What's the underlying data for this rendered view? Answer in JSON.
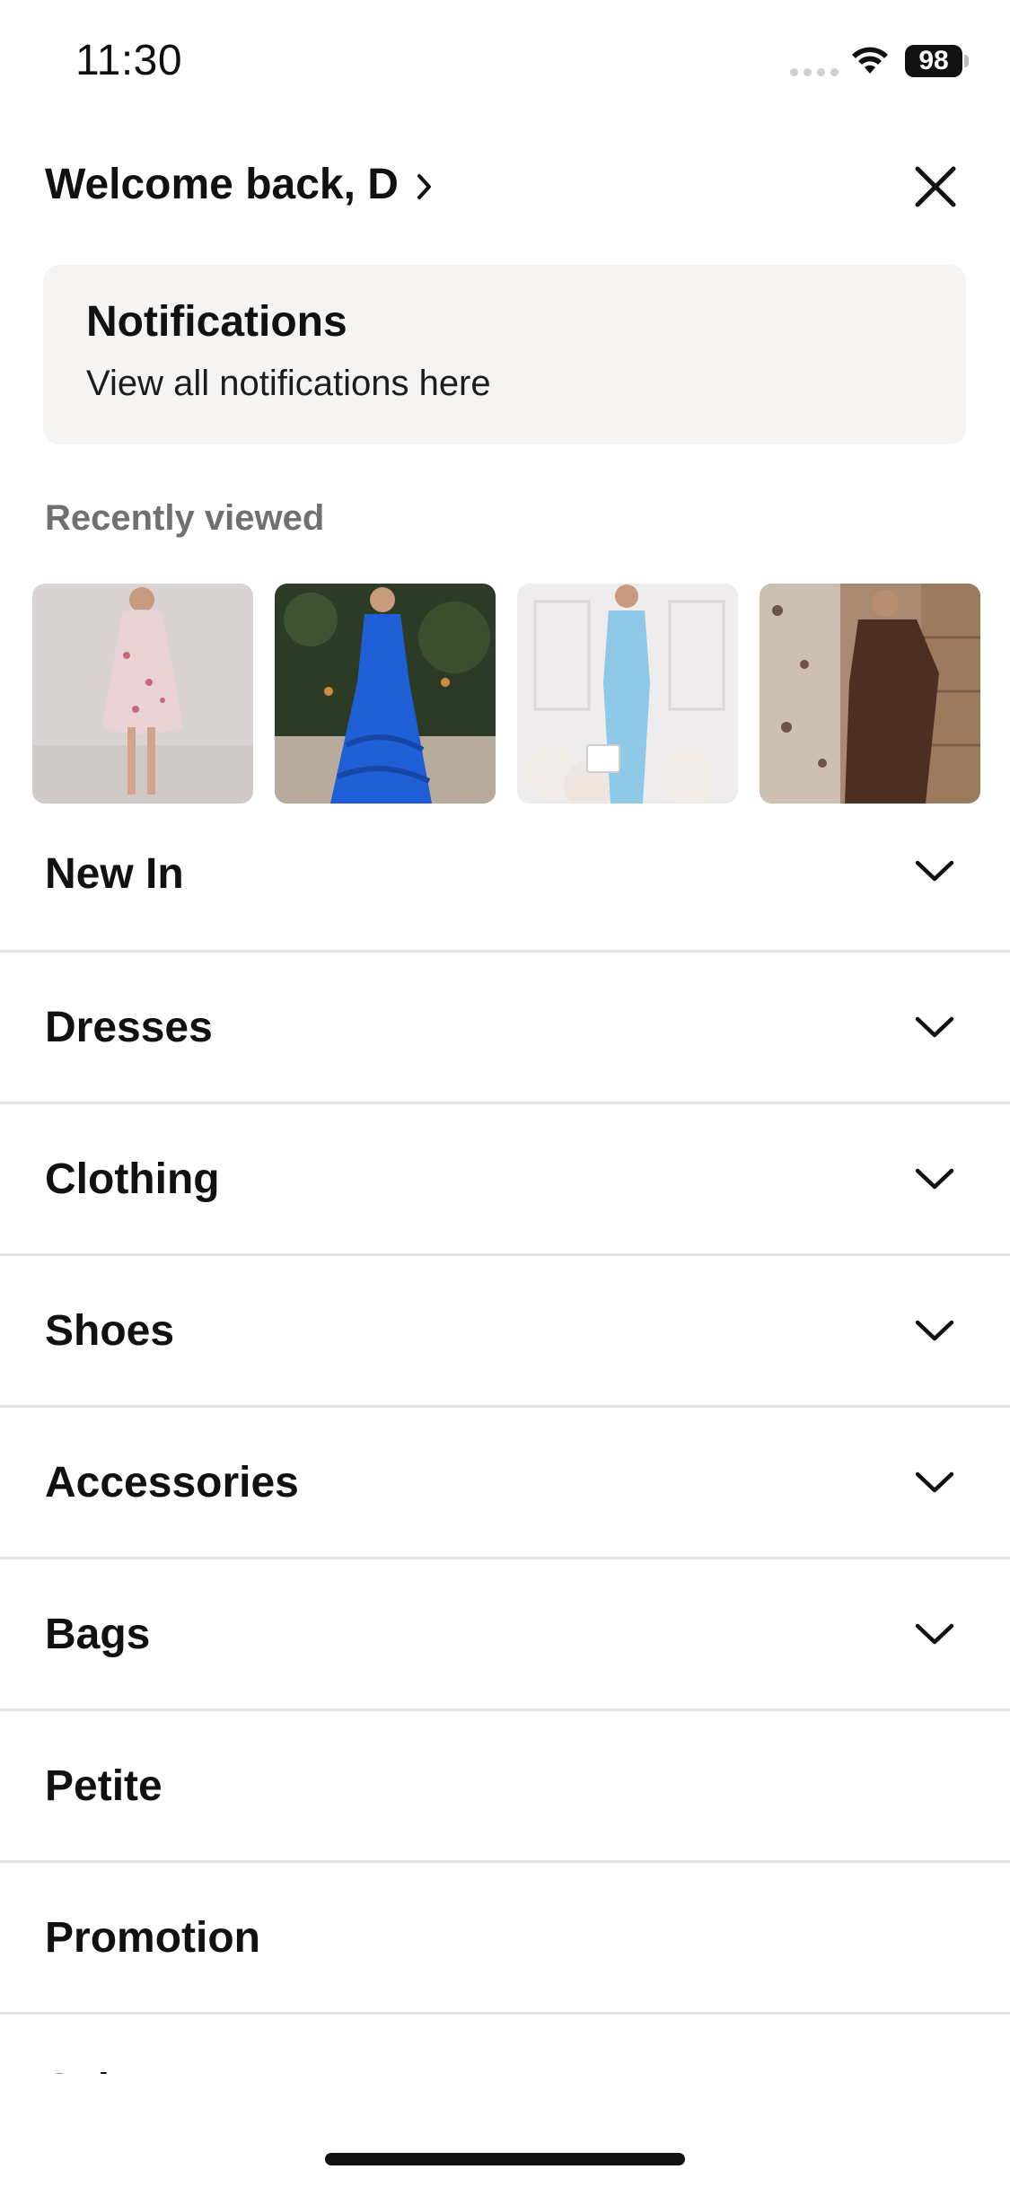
{
  "status_bar": {
    "time": "11:30",
    "battery": "98"
  },
  "header": {
    "welcome": "Welcome back, D",
    "welcome_icon": "chevron-right-icon",
    "close_icon": "close-icon"
  },
  "notifications": {
    "title": "Notifications",
    "subtitle": "View all notifications here"
  },
  "recently_viewed": {
    "label": "Recently viewed",
    "items": [
      {
        "name": "pink floral mini dress",
        "color": "#e9cdd0"
      },
      {
        "name": "blue ruffle maxi dress",
        "color": "#1f5fd6"
      },
      {
        "name": "light blue midi dress",
        "color": "#8ec9e8"
      },
      {
        "name": "brown knit sweater dress",
        "color": "#4a2f22"
      }
    ]
  },
  "categories": [
    {
      "label": "New In",
      "expandable": true
    },
    {
      "label": "Dresses",
      "expandable": true
    },
    {
      "label": "Clothing",
      "expandable": true
    },
    {
      "label": "Shoes",
      "expandable": true
    },
    {
      "label": "Accessories",
      "expandable": true
    },
    {
      "label": "Bags",
      "expandable": true
    },
    {
      "label": "Petite",
      "expandable": false
    },
    {
      "label": "Promotion",
      "expandable": false
    },
    {
      "label": "Sale",
      "expandable": true
    }
  ],
  "colors": {
    "card_bg": "#f5f4f2",
    "divider": "#e4e4e4",
    "muted_text": "#707070"
  }
}
